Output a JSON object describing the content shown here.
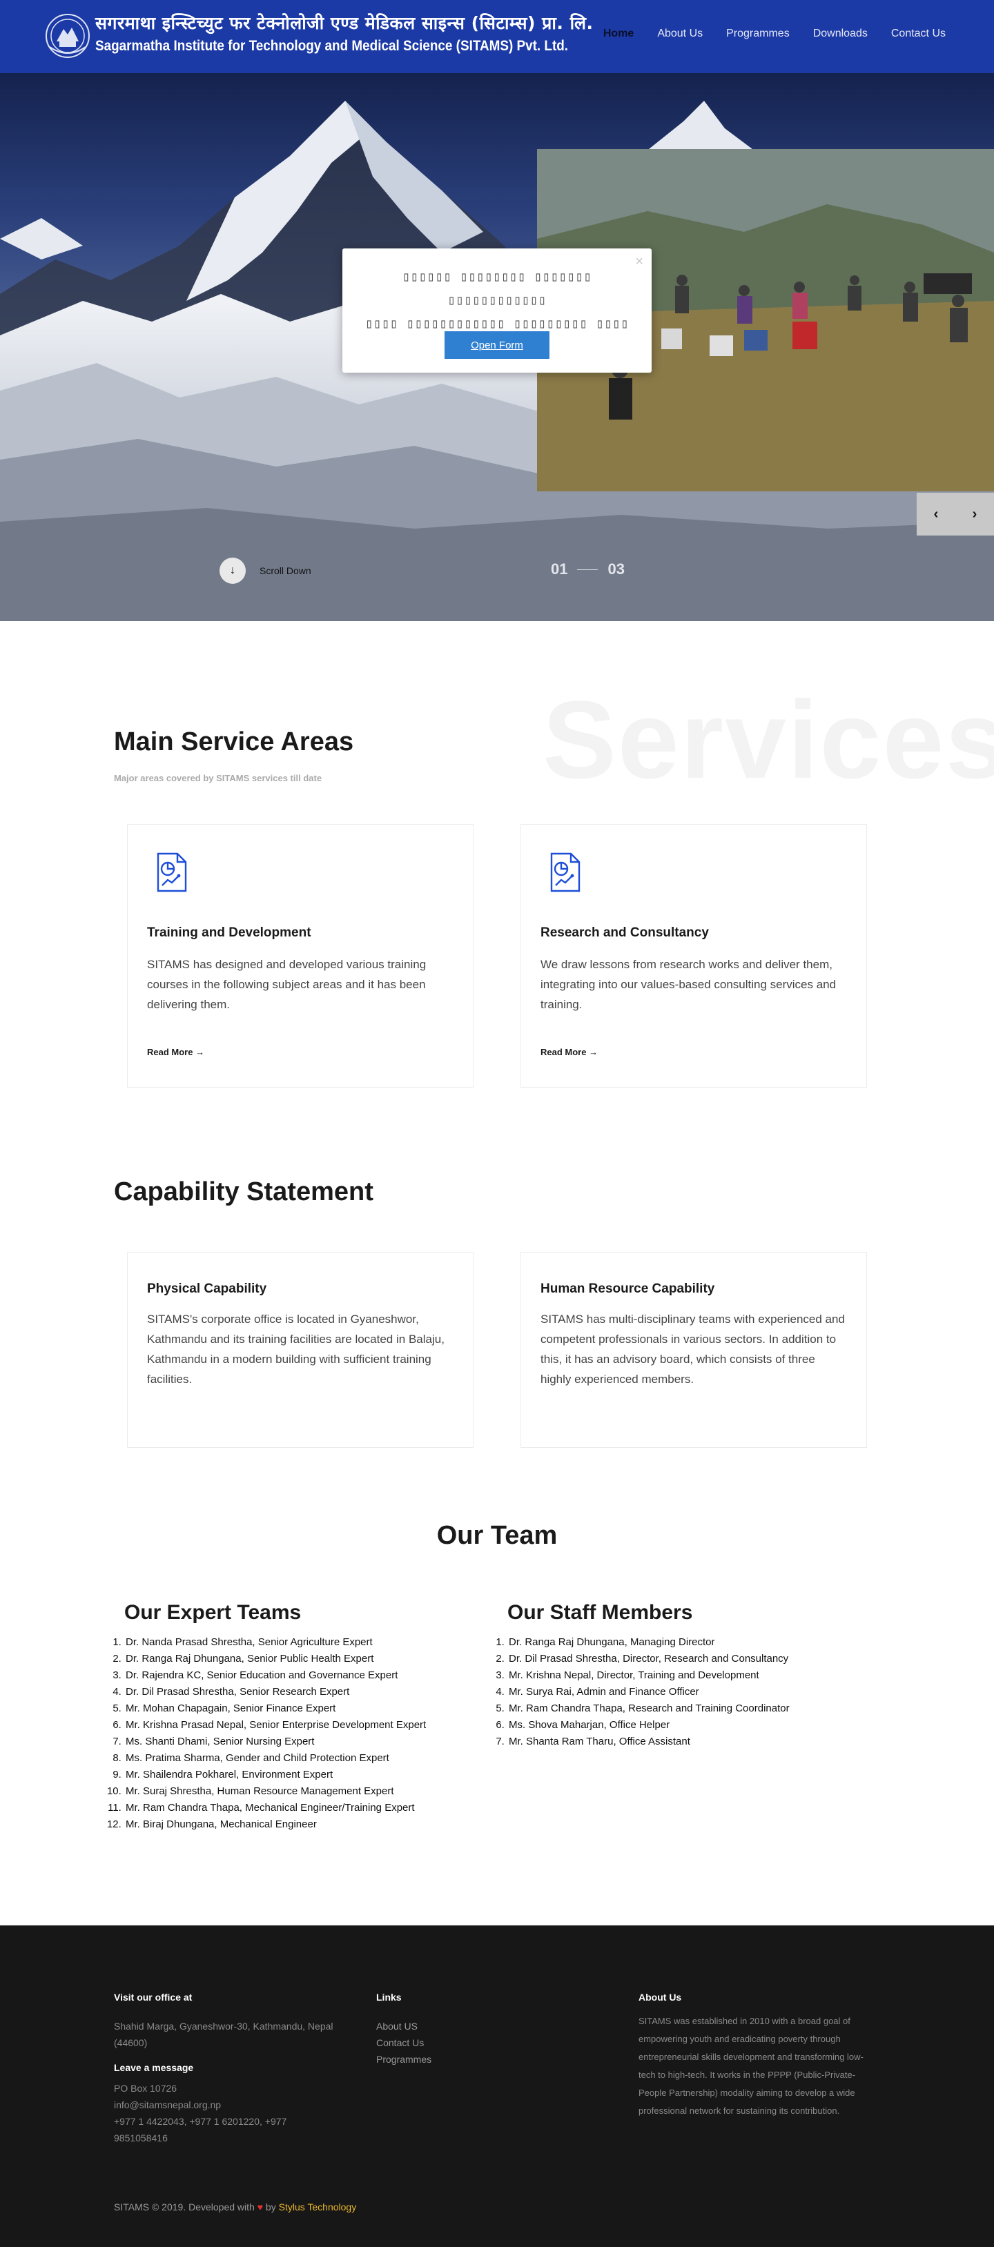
{
  "header": {
    "brand_hindi": "सगरमाथा इन्स्टिच्युट फर टेक्नोलोजी एण्ड मेडिकल साइन्स (सिटाम्स) प्रा. लि.",
    "brand_english": "Sagarmatha Institute for Technology and Medical Science (SITAMS) Pvt. Ltd.",
    "nav": [
      "Home",
      "About Us",
      "Programmes",
      "Downloads",
      "Contact Us"
    ]
  },
  "hero": {
    "modal_text_line1": "▯▯▯▯▯▯ ▯▯▯▯▯▯▯▯ ▯▯▯▯▯▯▯ ▯▯▯▯▯▯▯▯▯▯▯▯",
    "modal_text_line2": "▯▯▯▯ ▯▯▯▯▯▯▯▯▯▯▯▯ ▯▯▯▯▯▯▯▯▯ ▯▯▯▯",
    "modal_close": "×",
    "open_form_label": "Open Form",
    "scroll_down_label": "Scroll Down",
    "slide_current": "01",
    "slide_total": "03",
    "prev_arrow": "‹",
    "next_arrow": "›"
  },
  "services": {
    "bg_word": "Services",
    "title": "Main Service Areas",
    "subtitle": "Major areas covered by SITAMS services till date",
    "cards": [
      {
        "title": "Training and Development",
        "text": "SITAMS has designed and developed various training courses in the following subject areas and it has been delivering them.",
        "link": "Read More"
      },
      {
        "title": "Research and Consultancy",
        "text": "We draw lessons from research works and deliver them, integrating into our values-based consulting services and training.",
        "link": "Read More"
      }
    ]
  },
  "capability": {
    "title": "Capability Statement",
    "cards": [
      {
        "title": "Physical Capability",
        "text": "SITAMS's corporate office is located in Gyaneshwor, Kathmandu and its training facilities are located in Balaju, Kathmandu in a modern building with sufficient training facilities."
      },
      {
        "title": "Human Resource Capability",
        "text": "SITAMS has multi-disciplinary teams with experienced and competent professionals in various sectors. In addition to this, it has an advisory board, which consists of three highly experienced members."
      }
    ]
  },
  "team": {
    "title": "Our Team",
    "experts_title": "Our Expert Teams",
    "experts": [
      "Dr. Nanda Prasad Shrestha, Senior Agriculture Expert",
      "Dr. Ranga Raj Dhungana, Senior Public Health Expert",
      "Dr. Rajendra KC, Senior Education and Governance Expert",
      "Dr. Dil Prasad Shrestha, Senior Research Expert",
      "Mr. Mohan Chapagain, Senior Finance Expert",
      "Mr. Krishna Prasad Nepal, Senior Enterprise Development Expert",
      "Ms. Shanti Dhami, Senior Nursing Expert",
      "Ms. Pratima Sharma, Gender and Child Protection Expert",
      "Mr. Shailendra Pokharel, Environment Expert",
      "Mr. Suraj Shrestha, Human Resource Management Expert",
      "Mr. Ram Chandra Thapa, Mechanical Engineer/Training Expert",
      "Mr. Biraj Dhungana, Mechanical Engineer"
    ],
    "staff_title": "Our Staff Members",
    "staff": [
      "Dr. Ranga Raj Dhungana, Managing Director",
      "Dr. Dil Prasad Shrestha, Director, Research and Consultancy",
      "Mr. Krishna Nepal, Director, Training and Development",
      "Mr. Surya Rai, Admin and Finance Officer",
      "Mr. Ram Chandra Thapa, Research and Training Coordinator",
      "Ms. Shova Maharjan, Office Helper",
      "Mr. Shanta Ram Tharu, Office Assistant"
    ]
  },
  "footer": {
    "visit_heading": "Visit our office at",
    "address": "Shahid Marga, Gyaneshwor-30, Kathmandu, Nepal (44600)",
    "message_heading": "Leave a message",
    "po_box": "PO Box 10726",
    "email": "info@sitamsnepal.org.np",
    "phones": "+977 1 4422043, +977 1 6201220, +977 9851058416",
    "links_heading": "Links",
    "links": [
      "About US",
      "Contact Us",
      "Programmes"
    ],
    "about_heading": "About Us",
    "about_text": "SITAMS was established in 2010 with a broad goal of empowering youth and eradicating poverty through entrepreneurial skills development and transforming low-tech to high-tech. It works in the PPPP (Public-Private-People Partnership) modality aiming to develop a wide professional network for sustaining its contribution.",
    "copyright": "SITAMS © 2019. Developed with",
    "by": "by",
    "developer": "Stylus Technology"
  },
  "colors": {
    "header_bg": "#1c3aa6",
    "button_blue": "#2f80d1",
    "icon_blue": "#1d4ed8",
    "footer_bg": "#171717",
    "heart": "#e0322c",
    "developer_link": "#e9b62b"
  }
}
